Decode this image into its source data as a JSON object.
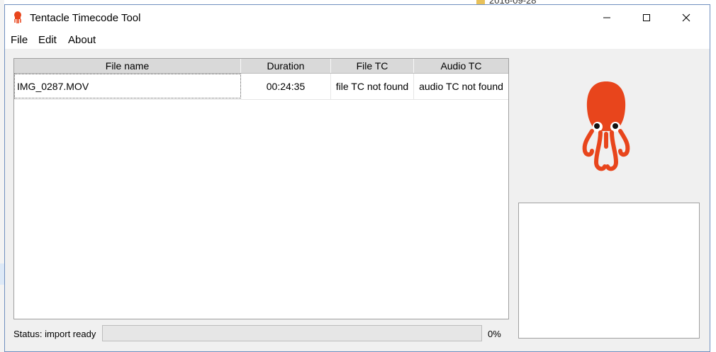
{
  "background": {
    "date_fragment": "2016-09-28"
  },
  "window": {
    "title": "Tentacle Timecode Tool",
    "controls": [
      "minimize-icon",
      "maximize-icon",
      "close-icon"
    ]
  },
  "menu": {
    "items": [
      {
        "label": "File"
      },
      {
        "label": "Edit"
      },
      {
        "label": "About"
      }
    ]
  },
  "table": {
    "columns": [
      "File name",
      "Duration",
      "File TC",
      "Audio TC"
    ],
    "rows": [
      {
        "file_name": "IMG_0287.MOV",
        "duration": "00:24:35",
        "file_tc": "file TC not found",
        "audio_tc": "audio TC not found"
      }
    ]
  },
  "logo": {
    "icon": "octopus-logo-icon",
    "color": "#e8451c"
  },
  "status": {
    "label": "Status: import ready",
    "progress_text": "0%",
    "progress_value": 0
  },
  "colors": {
    "accent": "#e8451c",
    "window_border": "#6f8fbf",
    "header_bg": "#d9d9d9"
  }
}
